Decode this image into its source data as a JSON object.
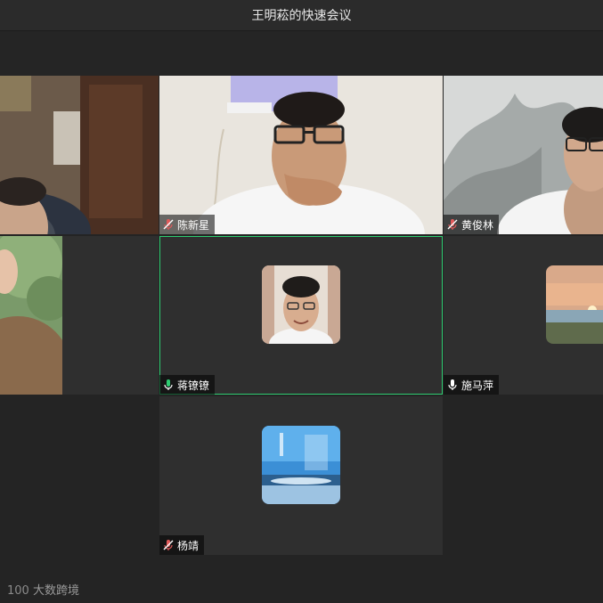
{
  "meeting": {
    "title": "王明菘的快速会议"
  },
  "participants": [
    {
      "name": "",
      "mic": "none"
    },
    {
      "name": "陈新星",
      "mic": "muted"
    },
    {
      "name": "黄俊林",
      "mic": "muted"
    },
    {
      "name": "",
      "mic": "none"
    },
    {
      "name": "蒋镣镣",
      "mic": "active-speaking"
    },
    {
      "name": "施马萍",
      "mic": "on"
    },
    {
      "name": "杨靖",
      "mic": "muted"
    }
  ],
  "watermark": {
    "text": "大数跨境",
    "logo": "100"
  },
  "colors": {
    "active_speaker": "#2ecc71",
    "muted_mic": "#e05a5a"
  }
}
